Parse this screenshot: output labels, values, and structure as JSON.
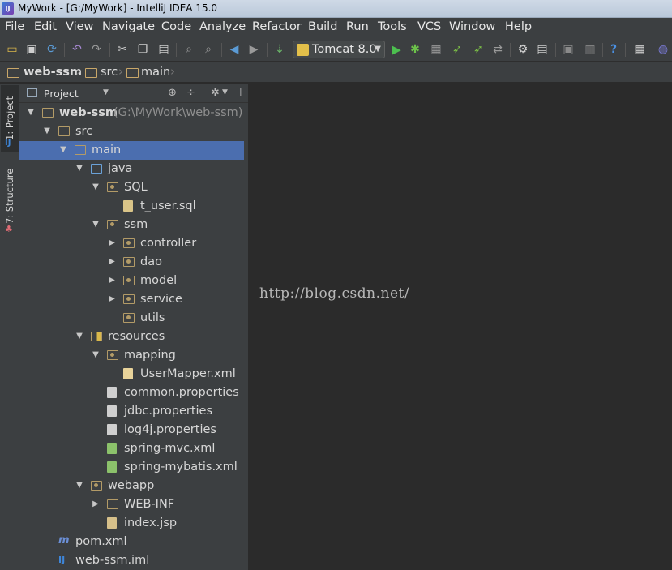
{
  "window": {
    "title": "MyWork - [G:/MyWork] - IntelliJ IDEA 15.0",
    "app_icon": "intellij-icon"
  },
  "menu": [
    "File",
    "Edit",
    "View",
    "Navigate",
    "Code",
    "Analyze",
    "Refactor",
    "Build",
    "Run",
    "Tools",
    "VCS",
    "Window",
    "Help"
  ],
  "toolbar": {
    "run_config": "Tomcat 8.0",
    "icons": [
      "open-folder-icon",
      "save-icon",
      "sync-icon",
      "undo-icon",
      "redo-icon",
      "cut-icon",
      "copy-icon",
      "paste-icon",
      "find-icon",
      "replace-icon",
      "back-icon",
      "forward-icon",
      "make-icon",
      "run-icon",
      "debug-icon",
      "coverage-icon",
      "profile-icon",
      "attach-icon",
      "update-icon",
      "project-structure-icon",
      "sdk-icon",
      "android-icon",
      "vcs-icon",
      "help-icon",
      "plugin-icon"
    ]
  },
  "breadcrumb": [
    "web-ssm",
    "src",
    "main"
  ],
  "toolstrip": {
    "project_tab": "1: Project",
    "structure_tab": "7: Structure"
  },
  "project_panel": {
    "title": "Project",
    "tree": [
      {
        "label": "web-ssm",
        "hint": "(G:\\MyWork\\web-ssm)",
        "depth": 0,
        "expanded": true,
        "icon": "module-folder"
      },
      {
        "label": "src",
        "depth": 1,
        "expanded": true,
        "icon": "folder"
      },
      {
        "label": "main",
        "depth": 2,
        "expanded": true,
        "icon": "folder",
        "selected": true
      },
      {
        "label": "java",
        "depth": 3,
        "expanded": true,
        "icon": "source-folder"
      },
      {
        "label": "SQL",
        "depth": 4,
        "expanded": true,
        "icon": "package"
      },
      {
        "label": "t_user.sql",
        "depth": 5,
        "icon": "sql-file"
      },
      {
        "label": "ssm",
        "depth": 4,
        "expanded": true,
        "icon": "package"
      },
      {
        "label": "controller",
        "depth": 5,
        "expanded": false,
        "icon": "package"
      },
      {
        "label": "dao",
        "depth": 5,
        "expanded": false,
        "icon": "package"
      },
      {
        "label": "model",
        "depth": 5,
        "expanded": false,
        "icon": "package"
      },
      {
        "label": "service",
        "depth": 5,
        "expanded": false,
        "icon": "package"
      },
      {
        "label": "utils",
        "depth": 5,
        "icon": "package"
      },
      {
        "label": "resources",
        "depth": 3,
        "expanded": true,
        "icon": "resources-folder"
      },
      {
        "label": "mapping",
        "depth": 4,
        "expanded": true,
        "icon": "package"
      },
      {
        "label": "UserMapper.xml",
        "depth": 5,
        "icon": "xml-file"
      },
      {
        "label": "common.properties",
        "depth": 4,
        "icon": "properties-file"
      },
      {
        "label": "jdbc.properties",
        "depth": 4,
        "icon": "properties-file"
      },
      {
        "label": "log4j.properties",
        "depth": 4,
        "icon": "properties-file"
      },
      {
        "label": "spring-mvc.xml",
        "depth": 4,
        "icon": "spring-xml-file"
      },
      {
        "label": "spring-mybatis.xml",
        "depth": 4,
        "icon": "spring-xml-file"
      },
      {
        "label": "webapp",
        "depth": 3,
        "expanded": true,
        "icon": "web-folder"
      },
      {
        "label": "WEB-INF",
        "depth": 4,
        "expanded": false,
        "icon": "folder"
      },
      {
        "label": "index.jsp",
        "depth": 4,
        "icon": "jsp-file"
      },
      {
        "label": "pom.xml",
        "depth": 1,
        "icon": "maven-file"
      },
      {
        "label": "web-ssm.iml",
        "depth": 1,
        "icon": "iml-file"
      }
    ]
  },
  "editor": {
    "watermark": "http://blog.csdn.net/"
  }
}
